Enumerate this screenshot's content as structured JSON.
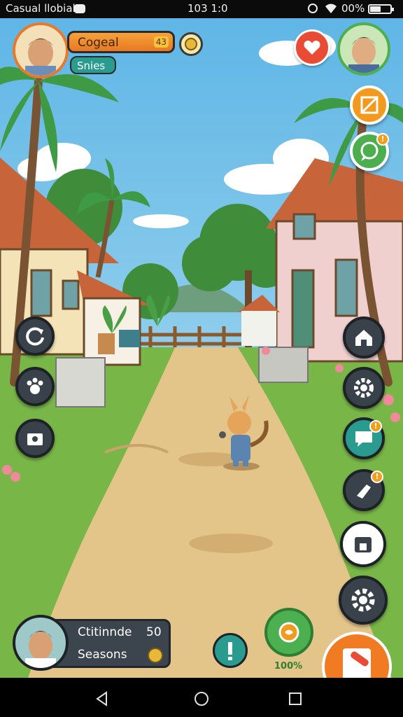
{
  "status_bar": {
    "app_title": "Casual llobial",
    "time": "103 1:0",
    "battery_percent": "00%"
  },
  "player": {
    "name_label": "Cogeal",
    "sub_label": "Snies",
    "name_badge": "43",
    "coin_icon": "coin-icon"
  },
  "bottom_panel": {
    "title": "Ctitinnde",
    "title_value": "50",
    "subtitle": "Seasons"
  },
  "bottom_center": {
    "gear_percent": "100%"
  },
  "right_column_icons": [
    "heart-icon",
    "profile-avatar",
    "edit-icon",
    "chat-icon",
    "house-icon",
    "settings-icon",
    "message-icon",
    "hand-icon",
    "shop-icon",
    "gear-icon",
    "book-icon"
  ],
  "left_column_icons": [
    "refresh-icon",
    "paw-icon",
    "camera-icon"
  ],
  "colors": {
    "orange_accent": "#f28a1f",
    "teal_accent": "#2a9b8f",
    "green_accent": "#4caf50",
    "dark_ui": "#1f252b"
  }
}
